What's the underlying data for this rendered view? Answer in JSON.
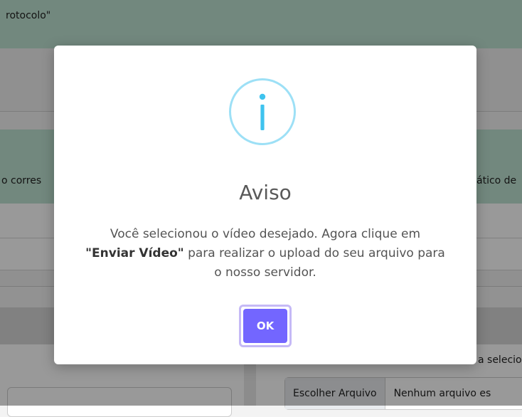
{
  "background": {
    "protocol_text": "rotocolo\"",
    "left_cell_text": "o corres",
    "right_cell_text": "ático de",
    "right_helper_text": "a selecio",
    "file_button_label": "Escolher Arquivo",
    "file_status": "Nenhum arquivo es"
  },
  "modal": {
    "icon": "info-icon",
    "title": "Aviso",
    "message_before": "Você selecionou o vídeo desejado. Agora clique em",
    "message_bold": "\"Enviar Vídeo\"",
    "message_after": "para realizar o upload do seu arquivo para o nosso servidor.",
    "ok_label": "OK"
  },
  "colors": {
    "accent_button": "#7366ff",
    "info_icon": "#3fc3ee"
  }
}
